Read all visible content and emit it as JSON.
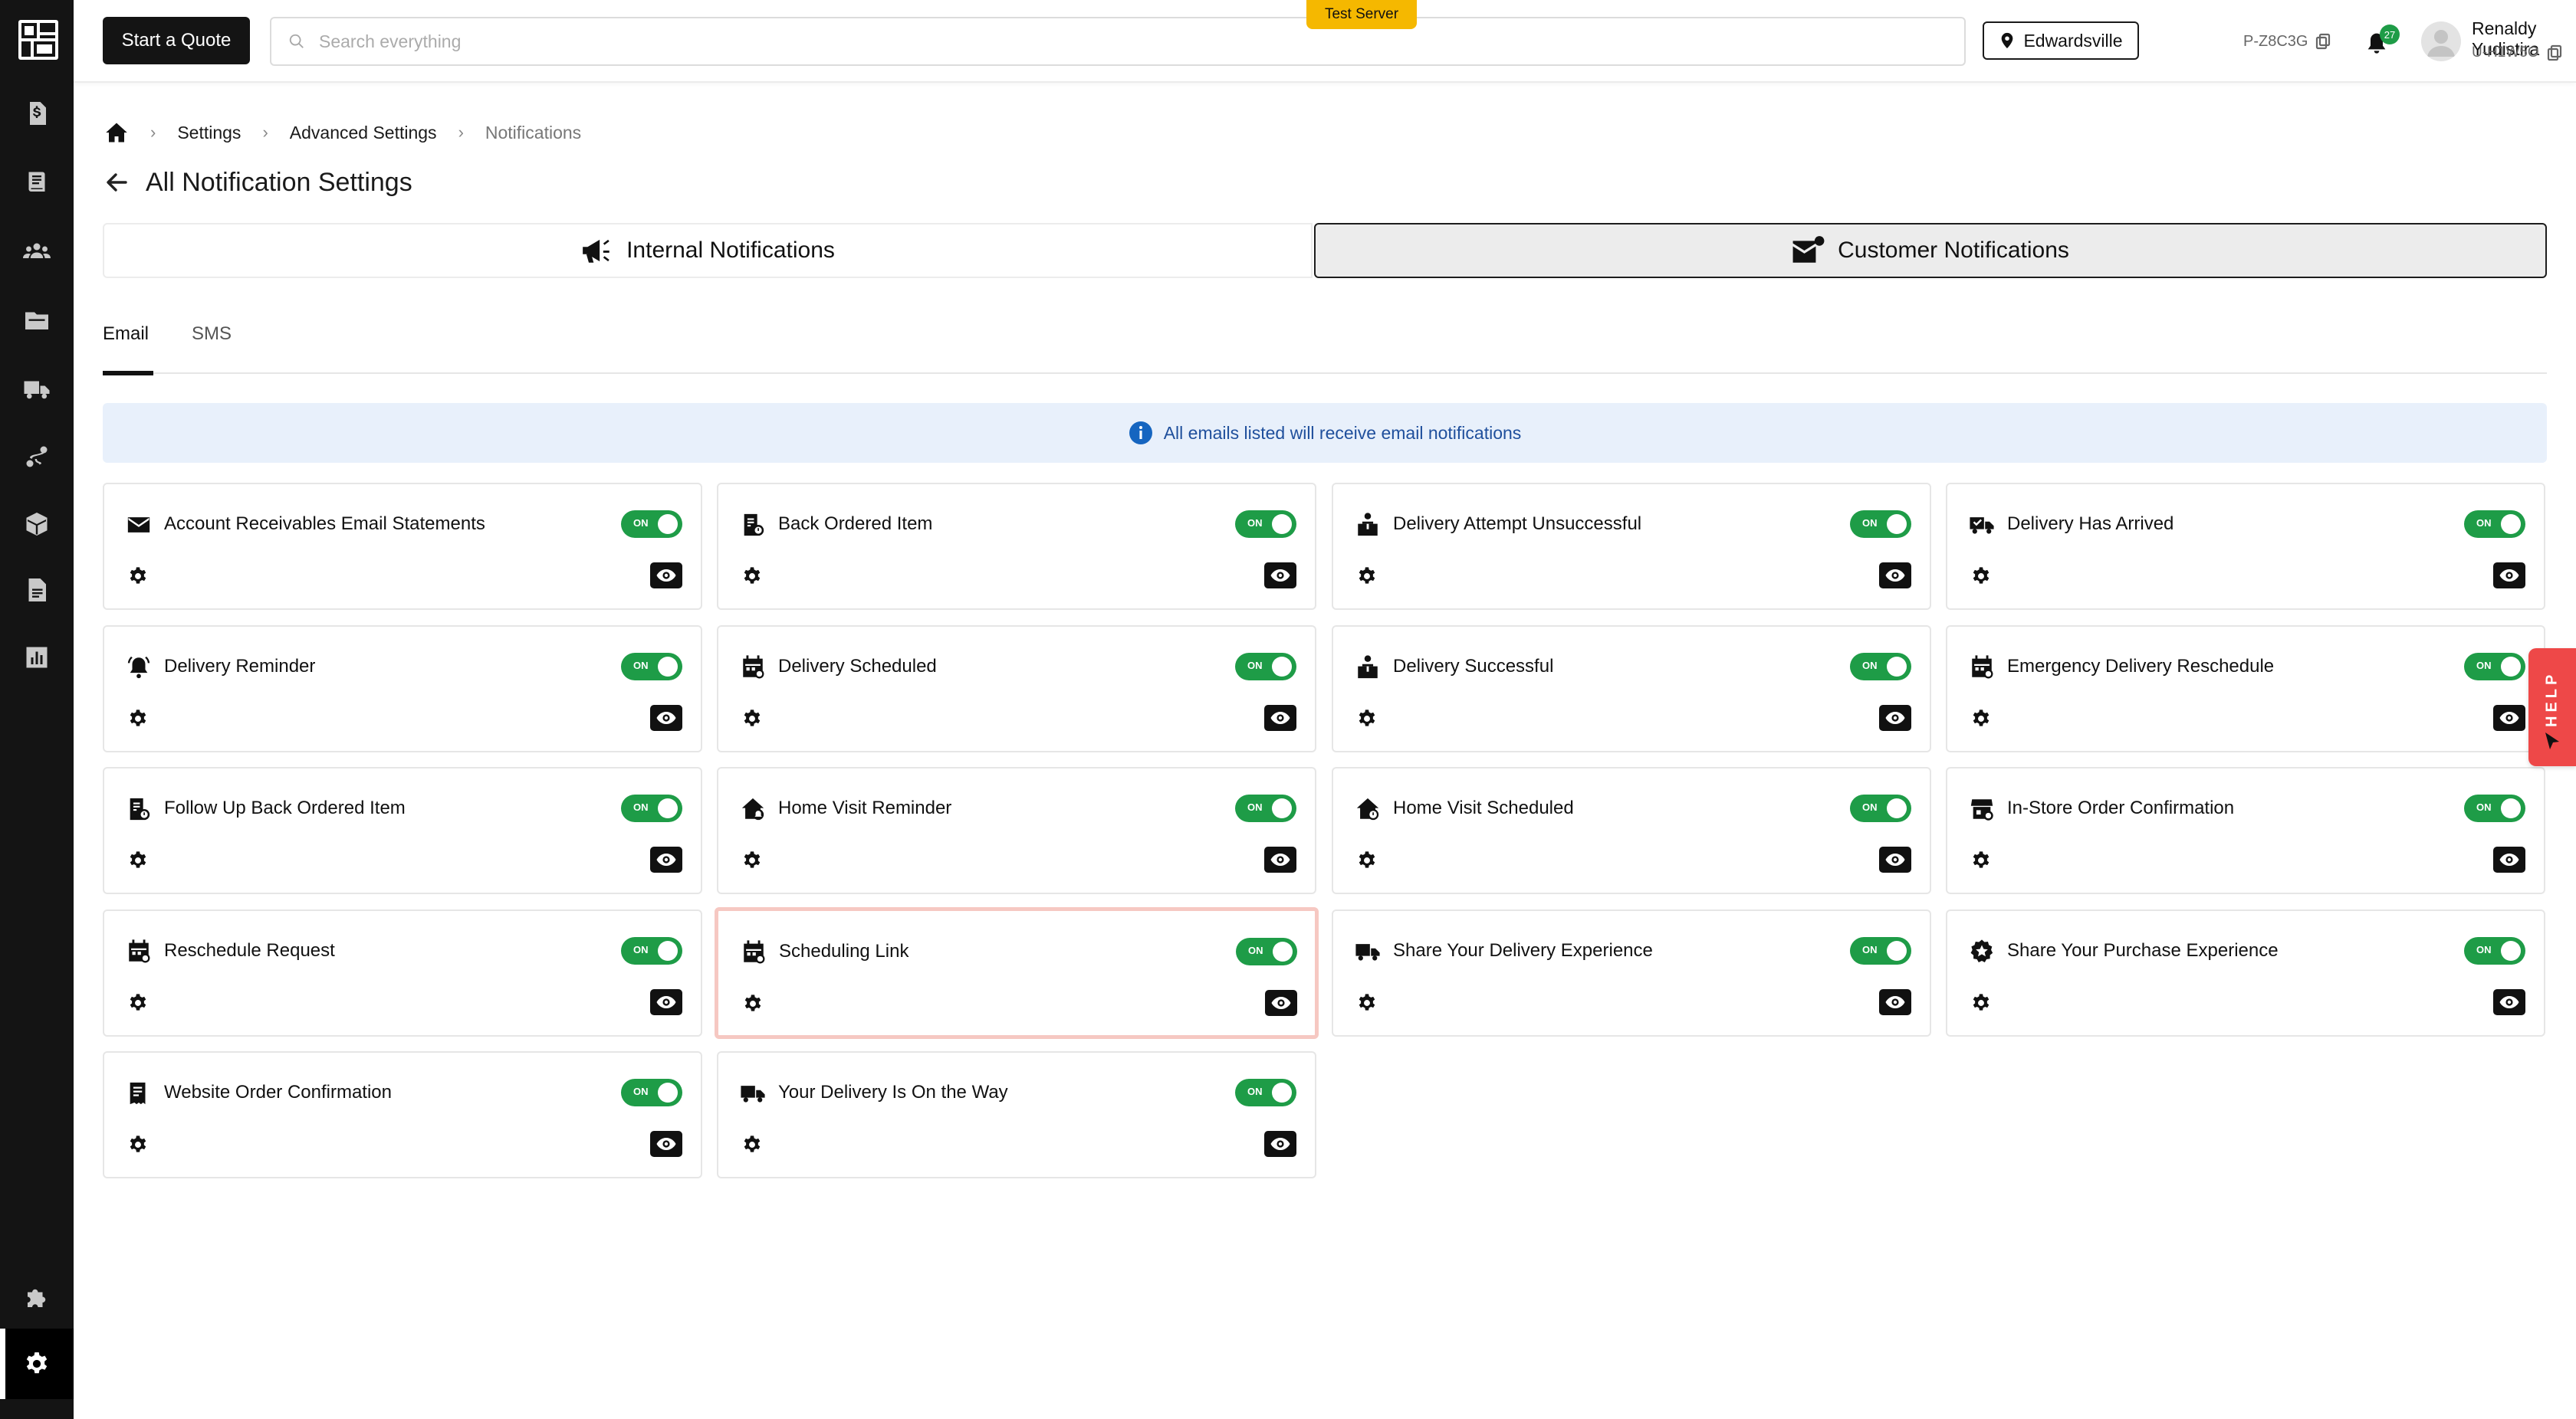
{
  "topbar": {
    "quote_button": "Start a Quote",
    "search_placeholder": "Search everything",
    "server_badge": "Test Server",
    "location": "Edwardsville",
    "profile_code": "P-Z8C3G",
    "notification_count": "27",
    "user_name": "Renaldy Yudistira",
    "user_id": "U-H1W5O"
  },
  "sidebar": {
    "items": [
      {
        "icon": "invoice-icon"
      },
      {
        "icon": "book-icon"
      },
      {
        "icon": "users-icon"
      },
      {
        "icon": "folder-icon"
      },
      {
        "icon": "truck-icon"
      },
      {
        "icon": "route-icon"
      },
      {
        "icon": "box-icon"
      },
      {
        "icon": "document-icon"
      },
      {
        "icon": "chart-icon"
      },
      {
        "icon": "puzzle-icon"
      },
      {
        "icon": "gear-icon",
        "active": true
      }
    ]
  },
  "breadcrumb": {
    "items": [
      "Settings",
      "Advanced Settings",
      "Notifications"
    ]
  },
  "page": {
    "title": "All Notification Settings"
  },
  "tabs": {
    "internal": "Internal Notifications",
    "customer": "Customer Notifications",
    "active": "customer"
  },
  "subtabs": {
    "email": "Email",
    "sms": "SMS",
    "active": "email"
  },
  "info": {
    "text": "All emails listed will receive email notifications"
  },
  "toggle_on_label": "ON",
  "help_label": "HELP",
  "colors": {
    "toggle_on": "#1e9c47",
    "info_bg": "#e8f0fb",
    "info_text": "#1f4f9c",
    "server_badge": "#f5b800",
    "help": "#ee4848",
    "sidebar": "#141414"
  },
  "cards": [
    {
      "title": "Account Receivables Email Statements",
      "icon": "envelope-icon",
      "enabled": true
    },
    {
      "title": "Back Ordered Item",
      "icon": "backorder-icon",
      "enabled": true
    },
    {
      "title": "Delivery Attempt Unsuccessful",
      "icon": "box-person-icon",
      "enabled": true
    },
    {
      "title": "Delivery Has Arrived",
      "icon": "truck-check-icon",
      "enabled": true
    },
    {
      "title": "Delivery Reminder",
      "icon": "bell-ring-icon",
      "enabled": true
    },
    {
      "title": "Delivery Scheduled",
      "icon": "calendar-icon",
      "enabled": true
    },
    {
      "title": "Delivery Successful",
      "icon": "box-person-icon",
      "enabled": true
    },
    {
      "title": "Emergency Delivery Reschedule",
      "icon": "calendar-icon",
      "enabled": true
    },
    {
      "title": "Follow Up Back Ordered Item",
      "icon": "backorder-icon",
      "enabled": true
    },
    {
      "title": "Home Visit Reminder",
      "icon": "home-bell-icon",
      "enabled": true
    },
    {
      "title": "Home Visit Scheduled",
      "icon": "home-clock-icon",
      "enabled": true
    },
    {
      "title": "In-Store Order Confirmation",
      "icon": "store-icon",
      "enabled": true
    },
    {
      "title": "Reschedule Request",
      "icon": "calendar-icon",
      "enabled": true
    },
    {
      "title": "Scheduling Link",
      "icon": "calendar-icon",
      "enabled": true,
      "highlighted": true
    },
    {
      "title": "Share Your Delivery Experience",
      "icon": "truck-icon",
      "enabled": true
    },
    {
      "title": "Share Your Purchase Experience",
      "icon": "star-badge-icon",
      "enabled": true
    },
    {
      "title": "Website Order Confirmation",
      "icon": "receipt-icon",
      "enabled": true
    },
    {
      "title": "Your Delivery Is On the Way",
      "icon": "truck-icon",
      "enabled": true
    }
  ]
}
